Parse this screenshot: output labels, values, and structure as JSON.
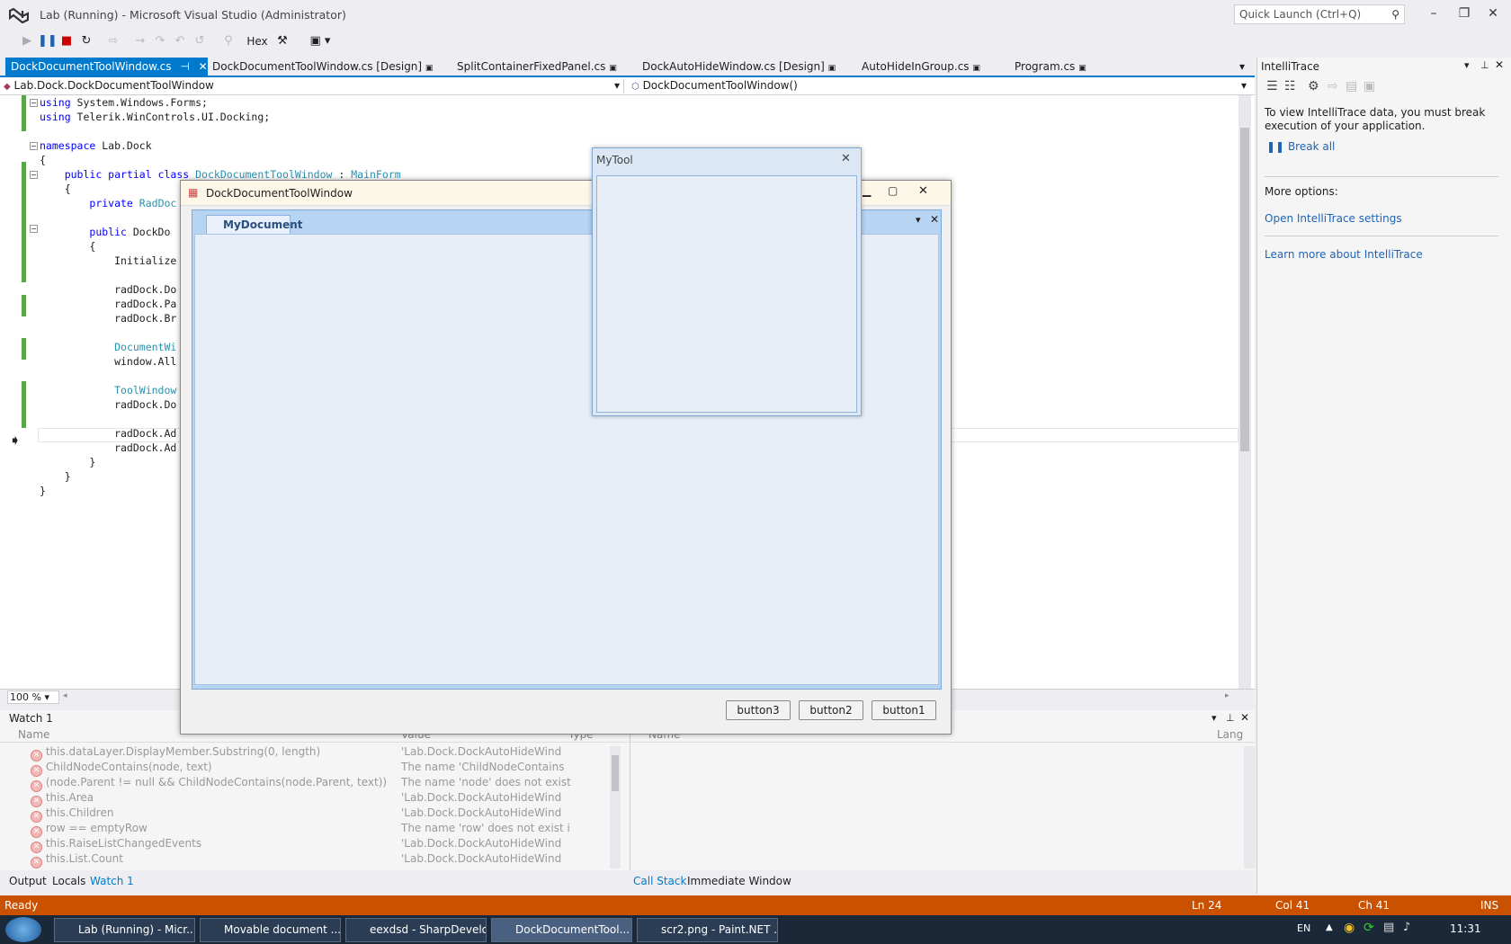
{
  "window": {
    "title": "Lab (Running) - Microsoft Visual Studio (Administrator)",
    "quick_launch_placeholder": "Quick Launch (Ctrl+Q)"
  },
  "toolbar": {
    "hex_label": "Hex"
  },
  "doc_tabs": [
    {
      "label": "DockDocumentToolWindow.cs"
    },
    {
      "label": "DockDocumentToolWindow.cs [Design]"
    },
    {
      "label": "SplitContainerFixedPanel.cs"
    },
    {
      "label": "DockAutoHideWindow.cs [Design]"
    },
    {
      "label": "AutoHideInGroup.cs"
    },
    {
      "label": "Program.cs"
    }
  ],
  "navbar": {
    "left": "Lab.Dock.DockDocumentToolWindow",
    "right": "DockDocumentToolWindow()"
  },
  "code_lines": [
    "using System.Windows.Forms;",
    "using Telerik.WinControls.UI.Docking;",
    "",
    "namespace Lab.Dock",
    "{",
    "    public partial class DockDocumentToolWindow : MainForm",
    "    {",
    "        private RadDoc",
    "",
    "        public DockDo",
    "        {",
    "            Initialize",
    "",
    "            radDock.Do",
    "            radDock.Pa",
    "            radDock.Br",
    "",
    "            DocumentWi",
    "            window.All",
    "",
    "            ToolWindow",
    "            radDock.Do",
    "",
    "            radDock.Ad",
    "            radDock.Ad",
    "        }",
    "    }",
    "}"
  ],
  "zoom": "100 %",
  "intellitrace": {
    "title": "IntelliTrace",
    "message": "To view IntelliTrace data, you must break execution of your application.",
    "break_all": "Break all",
    "more_options": "More options:",
    "open_settings": "Open IntelliTrace settings",
    "learn_more": "Learn more about IntelliTrace"
  },
  "watch": {
    "title": "Watch 1",
    "columns": [
      "Name",
      "Value",
      "Type"
    ],
    "rows": [
      {
        "name": "this.dataLayer.DisplayMember.Substring(0, length)",
        "value": "'Lab.Dock.DockAutoHideWind"
      },
      {
        "name": "ChildNodeContains(node, text)",
        "value": "The name 'ChildNodeContains"
      },
      {
        "name": "(node.Parent != null && ChildNodeContains(node.Parent, text))",
        "value": "The name 'node' does not exist"
      },
      {
        "name": "this.Area",
        "value": "'Lab.Dock.DockAutoHideWind"
      },
      {
        "name": "this.Children",
        "value": "'Lab.Dock.DockAutoHideWind"
      },
      {
        "name": "row == emptyRow",
        "value": "The name 'row' does not exist i"
      },
      {
        "name": "this.RaiseListChangedEvents",
        "value": "'Lab.Dock.DockAutoHideWind"
      },
      {
        "name": "this.List.Count",
        "value": "'Lab.Dock.DockAutoHideWind"
      }
    ]
  },
  "callstack": {
    "columns": [
      "Name",
      "Lang"
    ]
  },
  "bottom_tabs_left": [
    "Output",
    "Locals",
    "Watch 1"
  ],
  "bottom_tabs_right": [
    "Call Stack",
    "Immediate Window"
  ],
  "status": {
    "ready": "Ready",
    "ln": "Ln 24",
    "col": "Col 41",
    "ch": "Ch 41",
    "ins": "INS"
  },
  "taskbar": {
    "items": [
      "Lab (Running) - Micr...",
      "Movable document ...",
      "eexdsd - SharpDevelop",
      "DockDocumentTool...",
      "scr2.png - Paint.NET ..."
    ],
    "lang": "EN",
    "time": "11:31"
  },
  "form": {
    "title": "DockDocumentToolWindow",
    "doc_tab": "MyDocument",
    "buttons": [
      "button3",
      "button2",
      "button1"
    ]
  },
  "mytool": {
    "title": "MyTool"
  }
}
